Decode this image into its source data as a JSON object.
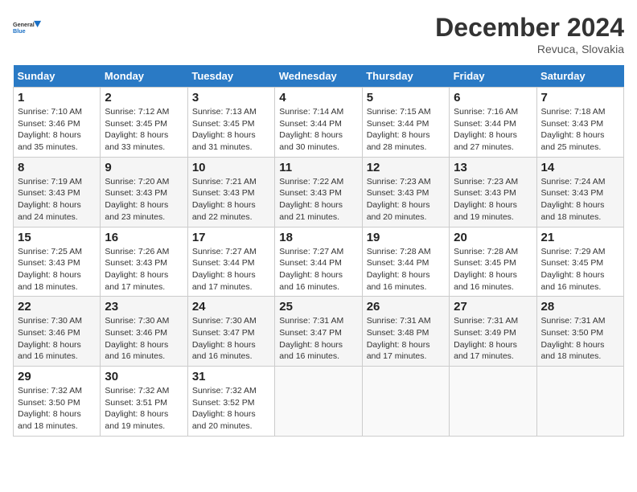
{
  "header": {
    "logo_line1": "General",
    "logo_line2": "Blue",
    "month_title": "December 2024",
    "subtitle": "Revuca, Slovakia"
  },
  "weekdays": [
    "Sunday",
    "Monday",
    "Tuesday",
    "Wednesday",
    "Thursday",
    "Friday",
    "Saturday"
  ],
  "weeks": [
    [
      {
        "day": "1",
        "sunrise": "Sunrise: 7:10 AM",
        "sunset": "Sunset: 3:46 PM",
        "daylight": "Daylight: 8 hours and 35 minutes."
      },
      {
        "day": "2",
        "sunrise": "Sunrise: 7:12 AM",
        "sunset": "Sunset: 3:45 PM",
        "daylight": "Daylight: 8 hours and 33 minutes."
      },
      {
        "day": "3",
        "sunrise": "Sunrise: 7:13 AM",
        "sunset": "Sunset: 3:45 PM",
        "daylight": "Daylight: 8 hours and 31 minutes."
      },
      {
        "day": "4",
        "sunrise": "Sunrise: 7:14 AM",
        "sunset": "Sunset: 3:44 PM",
        "daylight": "Daylight: 8 hours and 30 minutes."
      },
      {
        "day": "5",
        "sunrise": "Sunrise: 7:15 AM",
        "sunset": "Sunset: 3:44 PM",
        "daylight": "Daylight: 8 hours and 28 minutes."
      },
      {
        "day": "6",
        "sunrise": "Sunrise: 7:16 AM",
        "sunset": "Sunset: 3:44 PM",
        "daylight": "Daylight: 8 hours and 27 minutes."
      },
      {
        "day": "7",
        "sunrise": "Sunrise: 7:18 AM",
        "sunset": "Sunset: 3:43 PM",
        "daylight": "Daylight: 8 hours and 25 minutes."
      }
    ],
    [
      {
        "day": "8",
        "sunrise": "Sunrise: 7:19 AM",
        "sunset": "Sunset: 3:43 PM",
        "daylight": "Daylight: 8 hours and 24 minutes."
      },
      {
        "day": "9",
        "sunrise": "Sunrise: 7:20 AM",
        "sunset": "Sunset: 3:43 PM",
        "daylight": "Daylight: 8 hours and 23 minutes."
      },
      {
        "day": "10",
        "sunrise": "Sunrise: 7:21 AM",
        "sunset": "Sunset: 3:43 PM",
        "daylight": "Daylight: 8 hours and 22 minutes."
      },
      {
        "day": "11",
        "sunrise": "Sunrise: 7:22 AM",
        "sunset": "Sunset: 3:43 PM",
        "daylight": "Daylight: 8 hours and 21 minutes."
      },
      {
        "day": "12",
        "sunrise": "Sunrise: 7:23 AM",
        "sunset": "Sunset: 3:43 PM",
        "daylight": "Daylight: 8 hours and 20 minutes."
      },
      {
        "day": "13",
        "sunrise": "Sunrise: 7:23 AM",
        "sunset": "Sunset: 3:43 PM",
        "daylight": "Daylight: 8 hours and 19 minutes."
      },
      {
        "day": "14",
        "sunrise": "Sunrise: 7:24 AM",
        "sunset": "Sunset: 3:43 PM",
        "daylight": "Daylight: 8 hours and 18 minutes."
      }
    ],
    [
      {
        "day": "15",
        "sunrise": "Sunrise: 7:25 AM",
        "sunset": "Sunset: 3:43 PM",
        "daylight": "Daylight: 8 hours and 18 minutes."
      },
      {
        "day": "16",
        "sunrise": "Sunrise: 7:26 AM",
        "sunset": "Sunset: 3:43 PM",
        "daylight": "Daylight: 8 hours and 17 minutes."
      },
      {
        "day": "17",
        "sunrise": "Sunrise: 7:27 AM",
        "sunset": "Sunset: 3:44 PM",
        "daylight": "Daylight: 8 hours and 17 minutes."
      },
      {
        "day": "18",
        "sunrise": "Sunrise: 7:27 AM",
        "sunset": "Sunset: 3:44 PM",
        "daylight": "Daylight: 8 hours and 16 minutes."
      },
      {
        "day": "19",
        "sunrise": "Sunrise: 7:28 AM",
        "sunset": "Sunset: 3:44 PM",
        "daylight": "Daylight: 8 hours and 16 minutes."
      },
      {
        "day": "20",
        "sunrise": "Sunrise: 7:28 AM",
        "sunset": "Sunset: 3:45 PM",
        "daylight": "Daylight: 8 hours and 16 minutes."
      },
      {
        "day": "21",
        "sunrise": "Sunrise: 7:29 AM",
        "sunset": "Sunset: 3:45 PM",
        "daylight": "Daylight: 8 hours and 16 minutes."
      }
    ],
    [
      {
        "day": "22",
        "sunrise": "Sunrise: 7:30 AM",
        "sunset": "Sunset: 3:46 PM",
        "daylight": "Daylight: 8 hours and 16 minutes."
      },
      {
        "day": "23",
        "sunrise": "Sunrise: 7:30 AM",
        "sunset": "Sunset: 3:46 PM",
        "daylight": "Daylight: 8 hours and 16 minutes."
      },
      {
        "day": "24",
        "sunrise": "Sunrise: 7:30 AM",
        "sunset": "Sunset: 3:47 PM",
        "daylight": "Daylight: 8 hours and 16 minutes."
      },
      {
        "day": "25",
        "sunrise": "Sunrise: 7:31 AM",
        "sunset": "Sunset: 3:47 PM",
        "daylight": "Daylight: 8 hours and 16 minutes."
      },
      {
        "day": "26",
        "sunrise": "Sunrise: 7:31 AM",
        "sunset": "Sunset: 3:48 PM",
        "daylight": "Daylight: 8 hours and 17 minutes."
      },
      {
        "day": "27",
        "sunrise": "Sunrise: 7:31 AM",
        "sunset": "Sunset: 3:49 PM",
        "daylight": "Daylight: 8 hours and 17 minutes."
      },
      {
        "day": "28",
        "sunrise": "Sunrise: 7:31 AM",
        "sunset": "Sunset: 3:50 PM",
        "daylight": "Daylight: 8 hours and 18 minutes."
      }
    ],
    [
      {
        "day": "29",
        "sunrise": "Sunrise: 7:32 AM",
        "sunset": "Sunset: 3:50 PM",
        "daylight": "Daylight: 8 hours and 18 minutes."
      },
      {
        "day": "30",
        "sunrise": "Sunrise: 7:32 AM",
        "sunset": "Sunset: 3:51 PM",
        "daylight": "Daylight: 8 hours and 19 minutes."
      },
      {
        "day": "31",
        "sunrise": "Sunrise: 7:32 AM",
        "sunset": "Sunset: 3:52 PM",
        "daylight": "Daylight: 8 hours and 20 minutes."
      },
      null,
      null,
      null,
      null
    ]
  ]
}
